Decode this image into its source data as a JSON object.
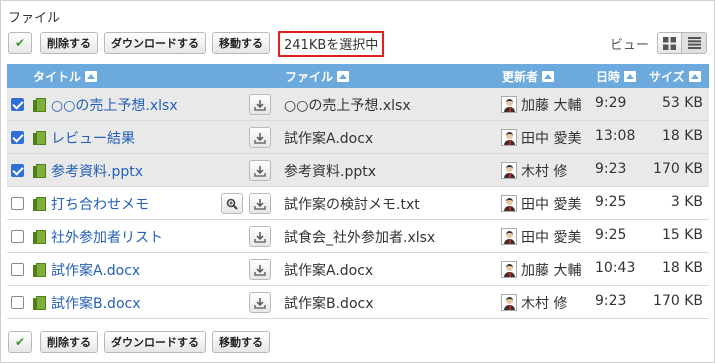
{
  "page_title": "ファイル",
  "toolbar": {
    "check_label": "✔",
    "delete_label": "削除する",
    "download_label": "ダウンロードする",
    "move_label": "移動する",
    "selection_info": "241KBを選択中"
  },
  "view": {
    "label": "ビュー"
  },
  "columns": {
    "title": "タイトル",
    "file": "ファイル",
    "updated_by": "更新者",
    "datetime": "日時",
    "size": "サイズ"
  },
  "rows": [
    {
      "checked": true,
      "title": "○○の売上予想.xlsx",
      "file": "○○の売上予想.xlsx",
      "author": "加藤 大輔",
      "time": "9:29",
      "size": "53 KB",
      "preview": false
    },
    {
      "checked": true,
      "title": "レビュー結果",
      "file": "試作案A.docx",
      "author": "田中 愛美",
      "time": "13:08",
      "size": "18 KB",
      "preview": false
    },
    {
      "checked": true,
      "title": "参考資料.pptx",
      "file": "参考資料.pptx",
      "author": "木村 修",
      "time": "9:23",
      "size": "170 KB",
      "preview": false
    },
    {
      "checked": false,
      "title": "打ち合わせメモ",
      "file": "試作案の検討メモ.txt",
      "author": "田中 愛美",
      "time": "9:25",
      "size": "3 KB",
      "preview": true
    },
    {
      "checked": false,
      "title": "社外参加者リスト",
      "file": "試食会_社外参加者.xlsx",
      "author": "田中 愛美",
      "time": "9:25",
      "size": "15 KB",
      "preview": false
    },
    {
      "checked": false,
      "title": "試作案A.docx",
      "file": "試作案A.docx",
      "author": "加藤 大輔",
      "time": "10:43",
      "size": "18 KB",
      "preview": false
    },
    {
      "checked": false,
      "title": "試作案B.docx",
      "file": "試作案B.docx",
      "author": "木村 修",
      "time": "9:23",
      "size": "170 KB",
      "preview": false
    }
  ]
}
